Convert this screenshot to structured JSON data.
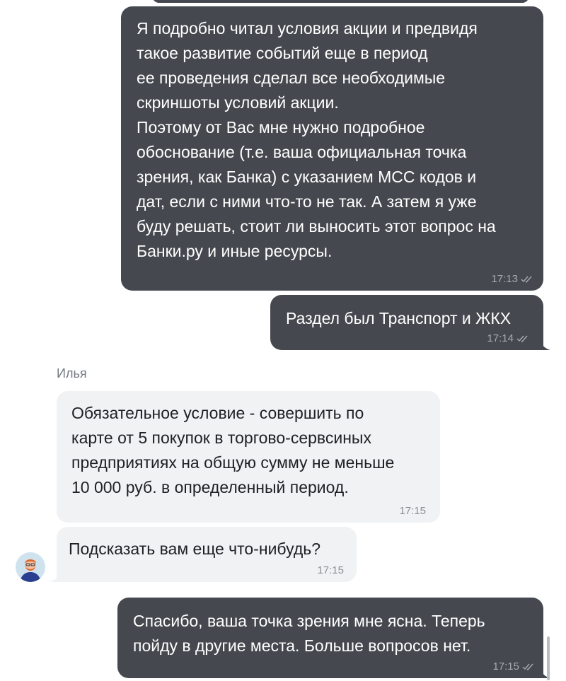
{
  "messages": [
    {
      "direction": "outgoing",
      "text": "Я подробно читал условия акции и предвидя\nтакое развитие событий еще в период\nее проведения сделал все необходимые\nскриншоты условий акции.\nПоэтому от Вас мне нужно подробное\nобоснование (т.е. ваша официальная точка\nзрения, как Банка) с указанием МСС кодов и\nдат, если с ними что-то не так. А затем я уже\nбуду решать, стоит ли выносить этот вопрос на\nБанки.ру и иные ресурсы.",
      "time": "17:13",
      "status": "read"
    },
    {
      "direction": "outgoing",
      "text": "Раздел был Транспорт и ЖКХ",
      "time": "17:14",
      "status": "read"
    },
    {
      "direction": "incoming",
      "sender": "Илья",
      "text": "Обязательное условие - совершить по\nкарте от 5 покупок в торгово-сервсиных\nпредприятиях на общую сумму не меньше\n10 000 руб. в определенный период.",
      "time": "17:15"
    },
    {
      "direction": "incoming",
      "text": "Подсказать вам еще что-нибудь?",
      "time": "17:15",
      "avatar": "bank-operator-avatar-icon"
    },
    {
      "direction": "outgoing",
      "text": "Спасибо, ваша точка зрения мне ясна. Теперь\nпойду в другие места. Больше вопросов нет.",
      "time": "17:15",
      "status": "read"
    }
  ],
  "colors": {
    "outgoing_bubble": "#45494f",
    "incoming_bubble": "#f1f2f4",
    "outgoing_text": "#ffffff",
    "incoming_text": "#1e2024"
  }
}
